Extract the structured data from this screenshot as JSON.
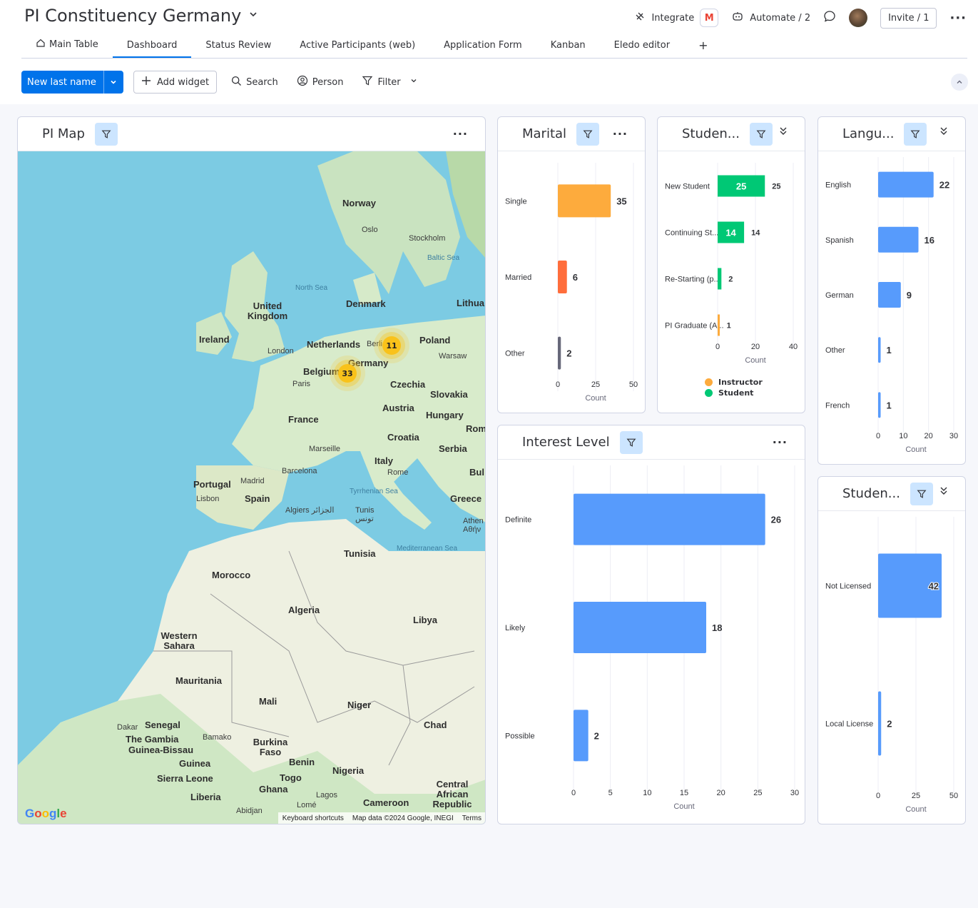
{
  "board": {
    "title": "PI Constituency Germany"
  },
  "topbar": {
    "integrate_label": "Integrate",
    "integrate_badge": "M",
    "automate_label": "Automate / 2",
    "invite_label": "Invite / 1"
  },
  "tabs": [
    {
      "label": "Main Table",
      "icon": "home-icon"
    },
    {
      "label": "Dashboard"
    },
    {
      "label": "Status Review"
    },
    {
      "label": "Active Participants (web)"
    },
    {
      "label": "Application Form"
    },
    {
      "label": "Kanban"
    },
    {
      "label": "Eledo editor"
    },
    {
      "label": "+"
    }
  ],
  "toolbar": {
    "new_item_label": "New last name",
    "add_widget_label": "Add widget",
    "search_label": "Search",
    "person_label": "Person",
    "filter_label": "Filter"
  },
  "map_widget": {
    "title": "PI Map",
    "clusters": [
      {
        "count": "11"
      },
      {
        "count": "33"
      }
    ],
    "labels": {
      "countries": [
        "Norway",
        "United Kingdom",
        "Ireland",
        "Denmark",
        "Netherlands",
        "Poland",
        "Belgium",
        "Germany",
        "Czechia",
        "Slovakia",
        "France",
        "Austria",
        "Hungary",
        "Croatia",
        "Serbia",
        "Italy",
        "Portugal",
        "Spain",
        "Greece",
        "Tunisia",
        "Morocco",
        "Algeria",
        "Libya",
        "Western Sahara",
        "Mauritania",
        "Mali",
        "Niger",
        "Chad",
        "Senegal",
        "The Gambia",
        "Guinea-Bissau",
        "Guinea",
        "Burkina Faso",
        "Benin",
        "Nigeria",
        "Sierra Leone",
        "Togo",
        "Ghana",
        "Liberia",
        "Central African Republic",
        "Cameroon",
        "Lithua",
        "Rom",
        "Bul"
      ],
      "cities": [
        "Oslo",
        "Stockholm",
        "London",
        "Berli",
        "Warsaw",
        "Paris",
        "Marseille",
        "Rome",
        "Madrid",
        "Barcelona",
        "Lisbon",
        "Algiers الجزائر",
        "Tunis تونس",
        "Athen Αθήν",
        "Dakar",
        "Bamako",
        "Abidjan",
        "Lomé",
        "Lagos"
      ],
      "seas": [
        "North Sea",
        "Baltic Sea",
        "Tyrrhenian Sea",
        "Mediterranean Sea"
      ]
    },
    "google_logo": "Google",
    "footer": [
      "Keyboard shortcuts",
      "Map data ©2024 Google, INEGI",
      "Terms"
    ]
  },
  "marital_widget": {
    "title": "Marital"
  },
  "student_type_widget": {
    "title": "Studen..."
  },
  "language_widget": {
    "title": "Langu..."
  },
  "interest_widget": {
    "title": "Interest Level"
  },
  "license_widget": {
    "title": "Studen..."
  },
  "chart_data": [
    {
      "id": "marital",
      "type": "bar",
      "orientation": "horizontal",
      "categories": [
        "Single",
        "Married",
        "Other"
      ],
      "values": [
        35,
        6,
        2
      ],
      "colors": [
        "#fdab3d",
        "#ff6d3b",
        "#676879"
      ],
      "xlabel": "Count",
      "xlim": [
        0,
        50
      ],
      "xticks": [
        0,
        25,
        50
      ]
    },
    {
      "id": "student_type",
      "type": "bar",
      "orientation": "horizontal",
      "stacked": true,
      "categories": [
        "New Student",
        "Continuing St...",
        "Re-Starting (p...",
        "PI Graduate (A..."
      ],
      "series": [
        {
          "name": "Instructor",
          "values": [
            0,
            0,
            0,
            1
          ],
          "color": "#fdab3d"
        },
        {
          "name": "Student",
          "values": [
            25,
            14,
            2,
            0
          ],
          "color": "#00c875"
        }
      ],
      "totals": [
        25,
        14,
        2,
        1
      ],
      "xlabel": "Count",
      "xlim": [
        0,
        40
      ],
      "xticks": [
        0,
        20,
        40
      ],
      "legend": "bottom"
    },
    {
      "id": "language",
      "type": "bar",
      "orientation": "horizontal",
      "categories": [
        "English",
        "Spanish",
        "German",
        "Other",
        "French"
      ],
      "values": [
        22,
        16,
        9,
        1,
        1
      ],
      "colors": [
        "#579bfc",
        "#579bfc",
        "#579bfc",
        "#579bfc",
        "#579bfc"
      ],
      "xlabel": "Count",
      "xlim": [
        0,
        30
      ],
      "xticks": [
        0,
        10,
        20,
        30
      ]
    },
    {
      "id": "interest",
      "type": "bar",
      "orientation": "horizontal",
      "categories": [
        "Definite",
        "Likely",
        "Possible"
      ],
      "values": [
        26,
        18,
        2
      ],
      "colors": [
        "#579bfc",
        "#579bfc",
        "#579bfc"
      ],
      "xlabel": "Count",
      "xlim": [
        0,
        30
      ],
      "xticks": [
        0,
        5,
        10,
        15,
        20,
        25,
        30
      ]
    },
    {
      "id": "license",
      "type": "bar",
      "orientation": "horizontal",
      "categories": [
        "Not Licensed",
        "Local License"
      ],
      "values": [
        42,
        2
      ],
      "colors": [
        "#579bfc",
        "#579bfc"
      ],
      "xlabel": "Count",
      "xlim": [
        0,
        50
      ],
      "xticks": [
        0,
        25,
        50
      ]
    }
  ],
  "colors": {
    "primary": "#0073ea",
    "filter_bg": "#cce5ff",
    "cluster": "#f9c21a"
  }
}
